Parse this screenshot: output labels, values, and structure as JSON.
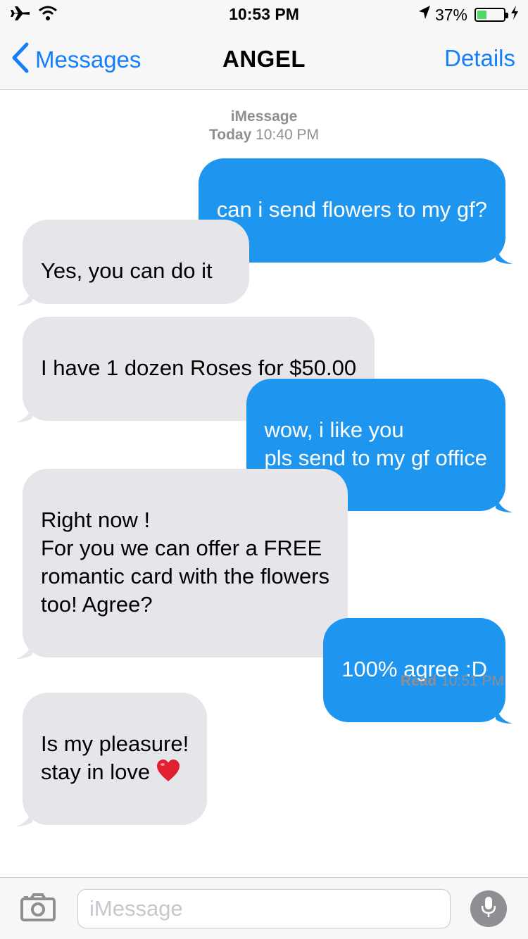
{
  "status_bar": {
    "time": "10:53 PM",
    "battery_percent": "37%",
    "battery_level": 0.37,
    "icons": [
      "airplane-icon",
      "wifi-icon",
      "location-icon",
      "battery-icon",
      "charging-icon"
    ]
  },
  "nav": {
    "back_label": "Messages",
    "title": "ANGEL",
    "details_label": "Details"
  },
  "conversation": {
    "service": "iMessage",
    "header_day": "Today",
    "header_time": "10:40 PM",
    "messages": [
      {
        "direction": "outgoing",
        "text": "can i send flowers to my gf?"
      },
      {
        "direction": "incoming",
        "text": "Yes, you can do it"
      },
      {
        "direction": "incoming",
        "text": "I have 1 dozen Roses for $50.00"
      },
      {
        "direction": "outgoing",
        "text": "wow, i like you\npls send to my gf office"
      },
      {
        "direction": "incoming",
        "text": "Right now !\nFor you we can offer a FREE\nromantic card with the flowers\ntoo! Agree?"
      },
      {
        "direction": "outgoing",
        "text": "100% agree :D"
      },
      {
        "direction": "incoming",
        "text": "Is my pleasure!\nstay in love",
        "emoji": "red-heart"
      }
    ],
    "read_label": "Read",
    "read_time": "10:51 PM"
  },
  "input": {
    "placeholder": "iMessage",
    "value": ""
  },
  "colors": {
    "accent": "#157efb",
    "outgoing_bubble": "#1e96f0",
    "incoming_bubble": "#e5e5ea",
    "meta_text": "#8e8e93"
  }
}
